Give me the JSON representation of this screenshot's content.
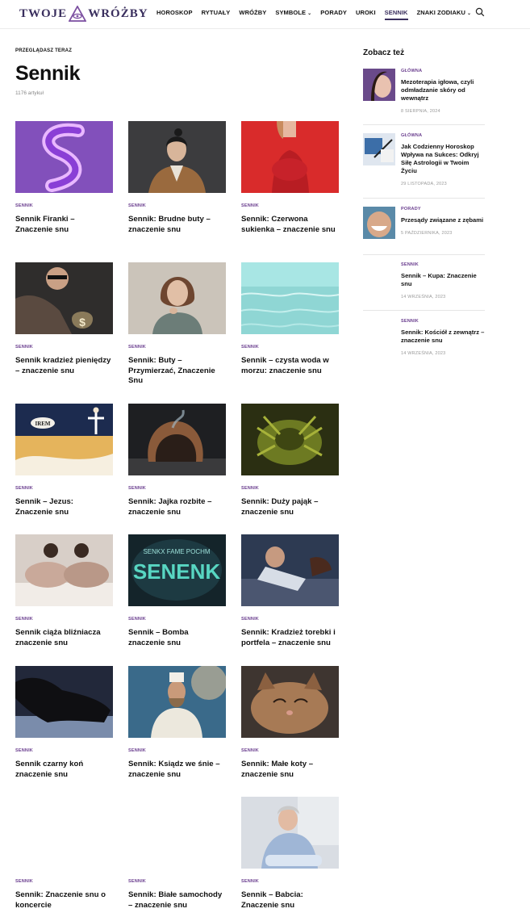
{
  "header": {
    "logo_left": "TWOJE",
    "logo_right": "WRÓŻBY",
    "nav": [
      {
        "label": "HOROSKOP",
        "dropdown": false,
        "active": false
      },
      {
        "label": "RYTUAŁY",
        "dropdown": false,
        "active": false
      },
      {
        "label": "WRÓŻBY",
        "dropdown": false,
        "active": false
      },
      {
        "label": "SYMBOLE",
        "dropdown": true,
        "active": false
      },
      {
        "label": "PORADY",
        "dropdown": false,
        "active": false
      },
      {
        "label": "UROKI",
        "dropdown": false,
        "active": false
      },
      {
        "label": "SENNIK",
        "dropdown": false,
        "active": true
      },
      {
        "label": "ZNAKI ZODIAKU",
        "dropdown": true,
        "active": false
      }
    ]
  },
  "main": {
    "kicker": "PRZEGLĄDASZ TERAZ",
    "title": "Sennik",
    "count": "1176 artykuł",
    "cards": [
      {
        "category": "SENNIK",
        "title": "Sennik Firanki – Znaczenie snu"
      },
      {
        "category": "SENNIK",
        "title": "Sennik: Brudne buty – znaczenie snu"
      },
      {
        "category": "SENNIK",
        "title": "Sennik: Czerwona sukienka – znaczenie snu"
      },
      {
        "category": "SENNIK",
        "title": "Sennik kradzież pieniędzy – znaczenie snu"
      },
      {
        "category": "SENNIK",
        "title": "Sennik: Buty – Przymierzać, Znaczenie Snu"
      },
      {
        "category": "SENNIK",
        "title": "Sennik – czysta woda w morzu: znaczenie snu"
      },
      {
        "category": "SENNIK",
        "title": "Sennik – Jezus: Znaczenie snu"
      },
      {
        "category": "SENNIK",
        "title": "Sennik: Jajka rozbite – znaczenie snu"
      },
      {
        "category": "SENNIK",
        "title": "Sennik: Duży pająk – znaczenie snu"
      },
      {
        "category": "SENNIK",
        "title": "Sennik ciąża bliźniacza znaczenie snu"
      },
      {
        "category": "SENNIK",
        "title": "Sennik – Bomba znaczenie snu"
      },
      {
        "category": "SENNIK",
        "title": "Sennik: Kradzież torebki i portfela – znaczenie snu"
      },
      {
        "category": "SENNIK",
        "title": "Sennik czarny koń znaczenie snu"
      },
      {
        "category": "SENNIK",
        "title": "Sennik: Ksiądz we śnie – znaczenie snu"
      },
      {
        "category": "SENNIK",
        "title": "Sennik: Małe koty – znaczenie snu"
      },
      {
        "category": "SENNIK",
        "title": "Sennik: Znaczenie snu o koncercie"
      },
      {
        "category": "SENNIK",
        "title": "Sennik: Białe samochody – znaczenie snu"
      },
      {
        "category": "SENNIK",
        "title": "Sennik – Babcia: Znaczenie snu"
      }
    ],
    "image_texts": {
      "jesus_sign": "IREM",
      "bomb_big": "SENENK",
      "bomb_small": "SENKX FAME POCHM"
    }
  },
  "sidebar": {
    "heading": "Zobacz też",
    "items": [
      {
        "category": "GŁÓWNA",
        "title": "Mezoterapia igłowa, czyli odmładzanie skóry od wewnątrz",
        "date": "8 SIERPNIA, 2024"
      },
      {
        "category": "GŁÓWNA",
        "title": "Jak Codzienny Horoskop Wpływa na Sukces: Odkryj Siłę Astrologii w Twoim Życiu",
        "date": "29 LISTOPADA, 2023"
      },
      {
        "category": "PORADY",
        "title": "Przesądy związane z zębami",
        "date": "5 PAŹDZIERNIKA, 2023"
      },
      {
        "category": "SENNIK",
        "title": "Sennik – Kupa: Znaczenie snu",
        "date": "14 WRZEŚNIA, 2023"
      },
      {
        "category": "SENNIK",
        "title": "Sennik: Kościół z zewnątrz – znaczenie snu",
        "date": "14 WRZEŚNIA, 2023"
      }
    ]
  },
  "colors": {
    "brand": "#3a2f5e",
    "category": "#6b3f8f",
    "muted": "#888888"
  }
}
